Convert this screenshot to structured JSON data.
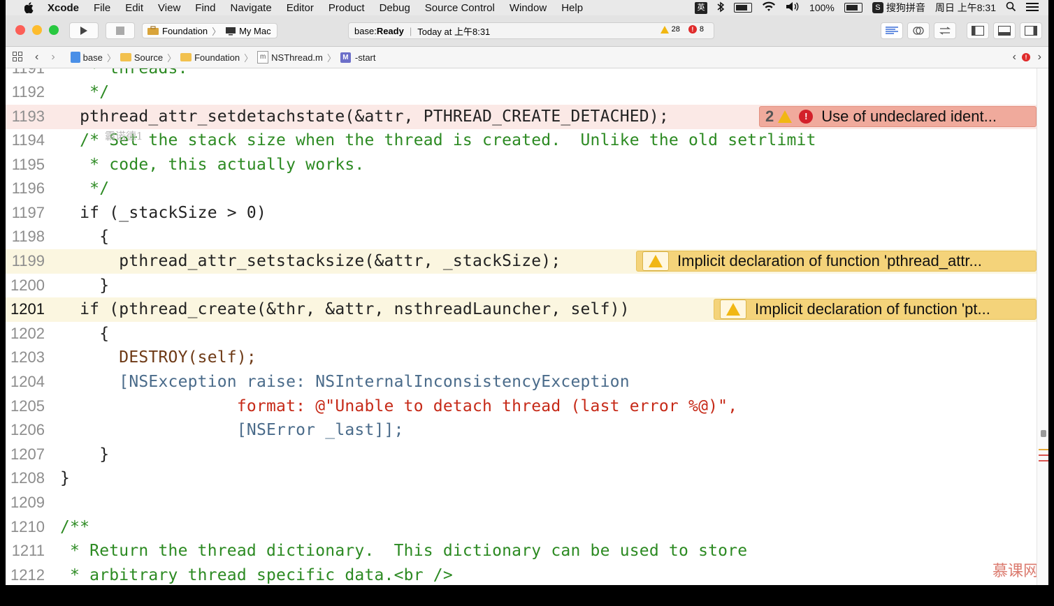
{
  "menubar": {
    "app": "Xcode",
    "items": [
      "File",
      "Edit",
      "View",
      "Find",
      "Navigate",
      "Editor",
      "Product",
      "Debug",
      "Source Control",
      "Window",
      "Help"
    ],
    "ime_label": "英",
    "battery": "100%",
    "input_method": "搜狗拼音",
    "clock": "周日 上午8:31"
  },
  "toolbar": {
    "scheme_target": "Foundation",
    "scheme_device": "My Mac",
    "status_project": "base: ",
    "status_state": "Ready",
    "status_time": "Today at 上午8:31",
    "warning_count": "28",
    "error_count": "8"
  },
  "jumpbar": {
    "crumbs": [
      "base",
      "Source",
      "Foundation",
      "NSThread.m",
      "-start"
    ],
    "method_icon": "M",
    "file_icon": "m"
  },
  "editor": {
    "lines": [
      {
        "n": "1191",
        "t": "   * threads."
      },
      {
        "n": "1192",
        "t": "   */"
      },
      {
        "n": "1193",
        "t": "  pthread_attr_setdetachstate(&attr, PTHREAD_CREATE_DETACHED);"
      },
      {
        "n": "1194",
        "t": "  /* Set the stack size when the thread is created.  Unlike the old setrlimit"
      },
      {
        "n": "1195",
        "t": "   * code, this actually works."
      },
      {
        "n": "1196",
        "t": "   */"
      },
      {
        "n": "1197",
        "t": "  if (_stackSize > 0)"
      },
      {
        "n": "1198",
        "t": "    {"
      },
      {
        "n": "1199",
        "t": "      pthread_attr_setstacksize(&attr, _stackSize);"
      },
      {
        "n": "1200",
        "t": "    }"
      },
      {
        "n": "1201",
        "t": "  if (pthread_create(&thr, &attr, nsthreadLauncher, self))"
      },
      {
        "n": "1202",
        "t": "    {"
      },
      {
        "n": "1203",
        "t": "      DESTROY(self);"
      },
      {
        "n": "1204",
        "t": "      [NSException raise: NSInternalInconsistencyException"
      },
      {
        "n": "1205",
        "t": "                  format: @\"Unable to detach thread (last error %@)\","
      },
      {
        "n": "1206",
        "t": "                  [NSError _last]];"
      },
      {
        "n": "1207",
        "t": "    }"
      },
      {
        "n": "1208",
        "t": "}"
      },
      {
        "n": "1209",
        "t": ""
      },
      {
        "n": "1210",
        "t": "/**"
      },
      {
        "n": "1211",
        "t": " * Return the thread dictionary.  This dictionary can be used to store"
      },
      {
        "n": "1212",
        "t": " * arbitrary thread specific data.<br />"
      }
    ],
    "issues": {
      "line1193": {
        "count": "2",
        "message": "Use of undeclared ident..."
      },
      "line1199": {
        "message": "Implicit declaration of function 'pthread_attr..."
      },
      "line1201": {
        "message": "Implicit declaration of function 'pt..."
      }
    },
    "overlay_text": "霸诺德1",
    "watermark": "慕课网"
  },
  "colors": {
    "error_bg": "#f0aa9c",
    "warning_bg": "#f4d37a",
    "comment": "#2c8a22",
    "keyword": "#a8239a"
  }
}
